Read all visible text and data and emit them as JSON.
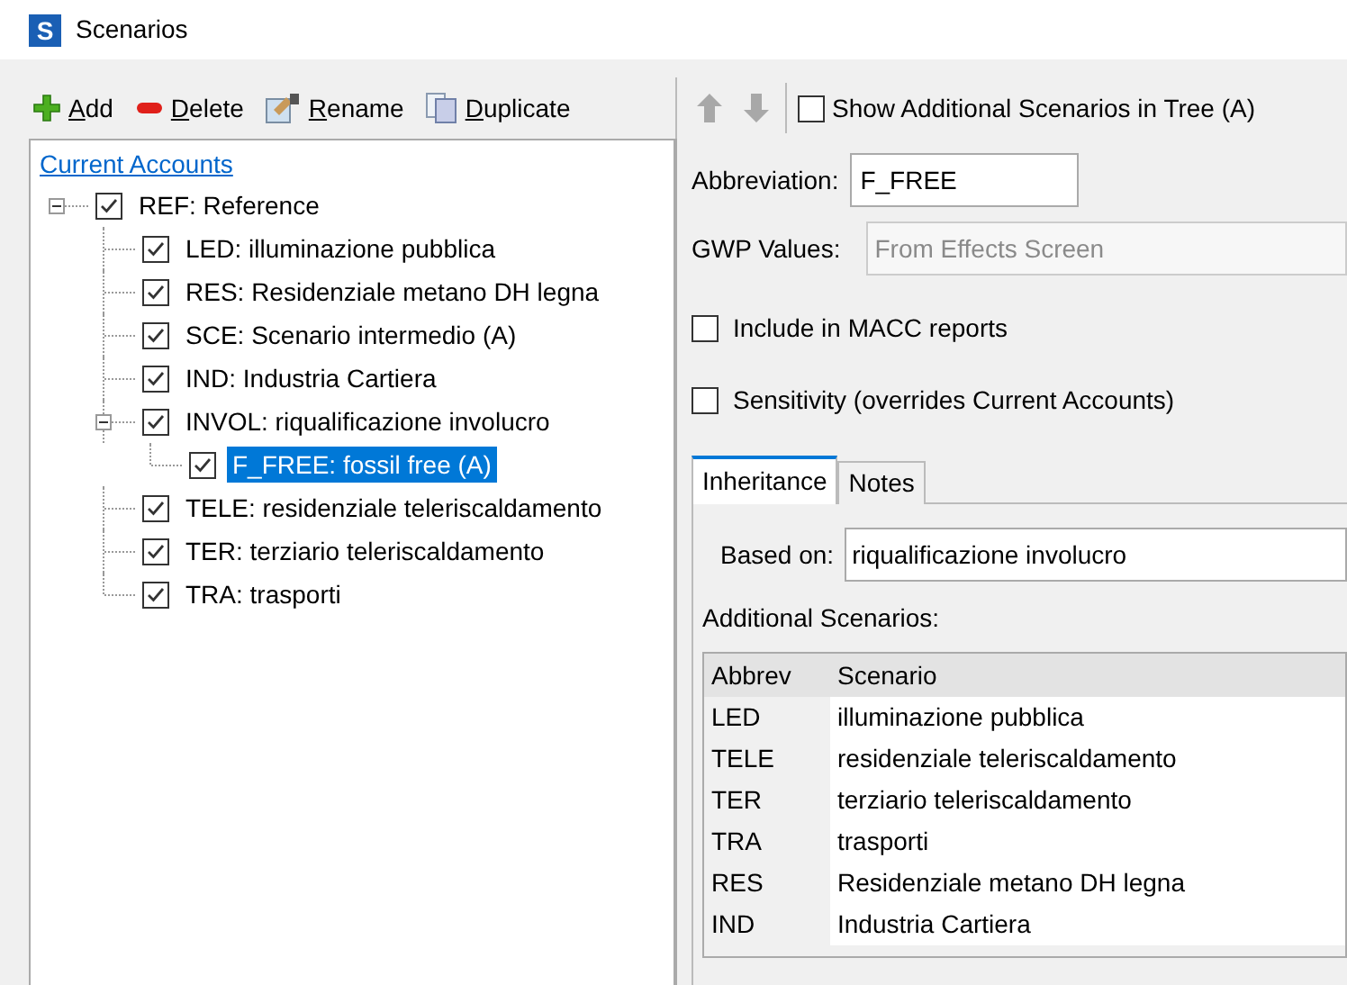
{
  "window": {
    "title": "Scenarios",
    "icon_letter": "S"
  },
  "toolbar": {
    "buttons": [
      {
        "kind": "add",
        "label": "Add"
      },
      {
        "kind": "delete",
        "label": "Delete"
      },
      {
        "kind": "rename",
        "label": "Rename"
      },
      {
        "kind": "duplicate",
        "label": "Duplicate"
      }
    ],
    "move_buttons": [
      {
        "kind": "up",
        "disabled": true
      },
      {
        "kind": "down",
        "disabled": true
      }
    ],
    "show_additional": {
      "label": "Show Additional Scenarios in Tree (A)",
      "checked": false
    }
  },
  "tree": {
    "link": "Current Accounts",
    "items": [
      {
        "label": "REF: Reference",
        "checked": true,
        "selected": false,
        "expanded": true,
        "children": [
          {
            "label": "LED: illuminazione pubblica",
            "checked": true,
            "selected": false
          },
          {
            "label": "RES: Residenziale metano DH legna",
            "checked": true,
            "selected": false
          },
          {
            "label": "SCE: Scenario intermedio (A)",
            "checked": true,
            "selected": false
          },
          {
            "label": "IND: Industria Cartiera",
            "checked": true,
            "selected": false
          },
          {
            "label": "INVOL: riqualificazione involucro",
            "checked": true,
            "selected": false,
            "expanded": true,
            "children": [
              {
                "label": "F_FREE: fossil free (A)",
                "checked": true,
                "selected": true
              }
            ]
          },
          {
            "label": "TELE: residenziale teleriscaldamento",
            "checked": true,
            "selected": false
          },
          {
            "label": "TER: terziario teleriscaldamento",
            "checked": true,
            "selected": false
          },
          {
            "label": "TRA: trasporti",
            "checked": true,
            "selected": false
          }
        ]
      }
    ]
  },
  "form": {
    "abbreviation_label": "Abbreviation:",
    "abbreviation_value": "F_FREE",
    "gwp_label": "GWP Values:",
    "gwp_value": "From Effects Screen",
    "gwp_disabled": true,
    "options": [
      {
        "label": "Include in MACC reports",
        "checked": false
      },
      {
        "label": "Sensitivity (overrides Current Accounts)",
        "checked": false
      }
    ]
  },
  "tabs": [
    {
      "label": "Inheritance",
      "selected": true
    },
    {
      "label": "Notes",
      "selected": false
    }
  ],
  "inheritance": {
    "based_on_label": "Based on:",
    "based_on_value": "riqualificazione involucro",
    "additional_label": "Additional Scenarios:",
    "columns": [
      "Abbrev",
      "Scenario"
    ],
    "rows": [
      [
        "LED",
        "illuminazione pubblica"
      ],
      [
        "TELE",
        "residenziale teleriscaldamento"
      ],
      [
        "TER",
        "terziario teleriscaldamento"
      ],
      [
        "TRA",
        "trasporti"
      ],
      [
        "RES",
        "Residenziale metano DH legna"
      ],
      [
        "IND",
        "Industria Cartiera"
      ]
    ]
  }
}
